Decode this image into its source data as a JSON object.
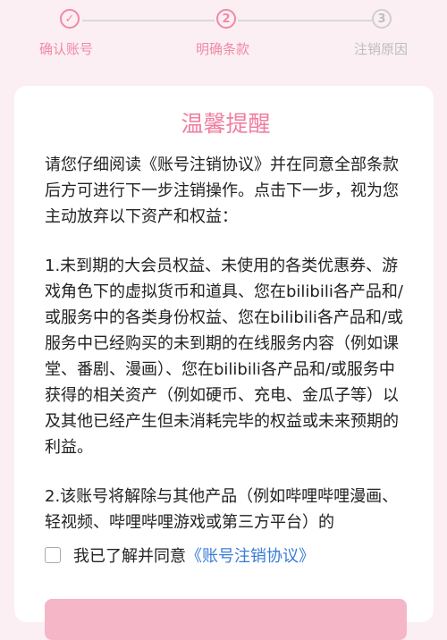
{
  "stepper": {
    "steps": [
      {
        "label": "确认账号",
        "mark": "✓",
        "state": "done"
      },
      {
        "label": "明确条款",
        "mark": "2",
        "state": "active"
      },
      {
        "label": "注销原因",
        "mark": "3",
        "state": "inactive"
      }
    ]
  },
  "card": {
    "title": "温馨提醒",
    "intro": "请您仔细阅读《账号注销协议》并在同意全部条款后方可进行下一步注销操作。点击下一步，视为您主动放弃以下资产和权益：",
    "item1": "1.未到期的大会员权益、未使用的各类优惠券、游戏角色下的虚拟货币和道具、您在bilibili各产品和/或服务中的各类身份权益、您在bilibili各产品和/或服务中已经购买的未到期的在线服务内容（例如课堂、番剧、漫画）、您在bilibili各产品和/或服务中获得的相关资产（例如硬币、充电、金瓜子等）以及其他已经产生但未消耗完毕的权益或未来预期的利益。",
    "item2": "2.该账号将解除与其他产品（例如哔哩哔哩漫画、轻视频、哔哩哔哩游戏或第三方平台）的"
  },
  "agreement": {
    "text": "我已了解并同意",
    "link": "《账号注销协议》"
  },
  "colors": {
    "accent": "#f08aa6",
    "inactive": "#bdbdbd",
    "link": "#3a7bd5",
    "button": "#f5b6c8",
    "background": "#fbeff3"
  }
}
